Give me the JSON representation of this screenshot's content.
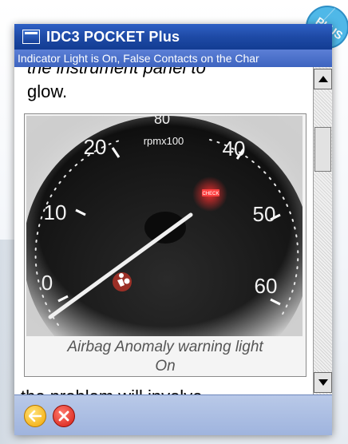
{
  "window": {
    "title": "IDC3 POCKET Plus",
    "subtitle": "Indicator Light is On, False Contacts on the Char"
  },
  "badge": {
    "text": "PLUS"
  },
  "content": {
    "cut_line": "the   instrument   panel   to",
    "first_line": "glow.",
    "gauge_labels": {
      "top": "80",
      "unit": "rpmx100",
      "n20": "20",
      "n40": "40",
      "n10": "10",
      "n50": "50",
      "n0": "0",
      "n60": "60",
      "check": "CHECK"
    },
    "caption_line1": "Airbag Anomaly warning light",
    "caption_line2": "On",
    "next_text": "the problem will involve"
  },
  "buttons": {
    "back": "back",
    "close": "close"
  },
  "colors": {
    "titlebar": "#1e4aa6",
    "subtitle_bar": "#4a6fcc",
    "bottom_bar": "#a9bce2",
    "back_button": "#f3a500",
    "close_button": "#d41b12",
    "badge": "#4fb8e8"
  }
}
